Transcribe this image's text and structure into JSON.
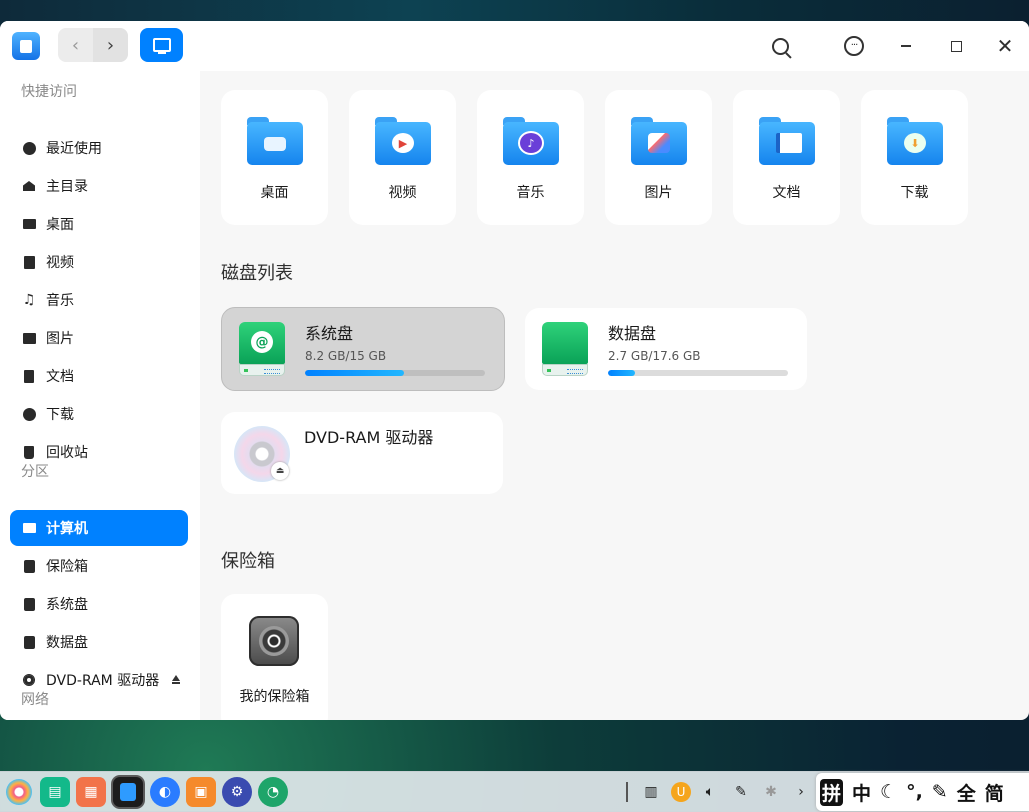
{
  "window": {
    "sidebar": {
      "sections": [
        {
          "label": "快捷访问",
          "items": [
            {
              "label": "最近使用",
              "icon": "clock-icon"
            },
            {
              "label": "主目录",
              "icon": "home-icon"
            },
            {
              "label": "桌面",
              "icon": "desktop-icon"
            },
            {
              "label": "视频",
              "icon": "video-icon"
            },
            {
              "label": "音乐",
              "icon": "music-icon"
            },
            {
              "label": "图片",
              "icon": "picture-icon"
            },
            {
              "label": "文档",
              "icon": "document-icon"
            },
            {
              "label": "下载",
              "icon": "download-icon"
            },
            {
              "label": "回收站",
              "icon": "trash-icon"
            }
          ]
        },
        {
          "label": "分区",
          "items": [
            {
              "label": "计算机",
              "icon": "computer-icon",
              "active": true
            },
            {
              "label": "保险箱",
              "icon": "vault-icon"
            },
            {
              "label": "系统盘",
              "icon": "disk-icon"
            },
            {
              "label": "数据盘",
              "icon": "disk-icon"
            },
            {
              "label": "DVD-RAM 驱动器",
              "icon": "disc-icon",
              "eject": true
            }
          ]
        },
        {
          "label": "网络",
          "items": []
        }
      ]
    },
    "quick_access": [
      {
        "label": "桌面",
        "icon": "desktop-folder-icon"
      },
      {
        "label": "视频",
        "icon": "video-folder-icon"
      },
      {
        "label": "音乐",
        "icon": "music-folder-icon"
      },
      {
        "label": "图片",
        "icon": "picture-folder-icon"
      },
      {
        "label": "文档",
        "icon": "document-folder-icon"
      },
      {
        "label": "下载",
        "icon": "download-folder-icon"
      }
    ],
    "disk_section_title": "磁盘列表",
    "disks": [
      {
        "name": "系统盘",
        "size": "8.2 GB/15 GB",
        "usage": 0.55,
        "selected": true
      },
      {
        "name": "数据盘",
        "size": "2.7 GB/17.6 GB",
        "usage": 0.15,
        "selected": false
      }
    ],
    "dvd": {
      "name": "DVD-RAM 驱动器"
    },
    "vault_section_title": "保险箱",
    "vault": {
      "label": "我的保险箱"
    }
  },
  "ime": {
    "mode": "拼",
    "lang": "中",
    "symbols": "°,",
    "width": "全",
    "script": "简"
  },
  "colors": {
    "accent": "#0081ff",
    "disk_green": "#0aa257"
  }
}
